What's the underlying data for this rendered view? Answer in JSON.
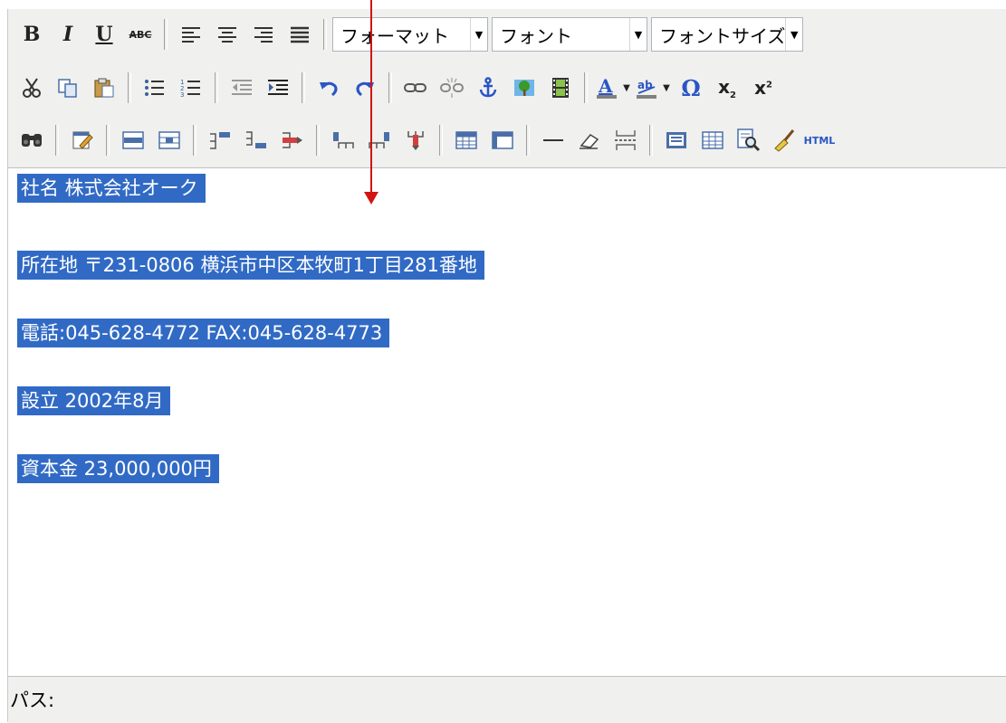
{
  "toolbar": {
    "row1": {
      "format_select": "フォーマット",
      "font_select": "フォント",
      "fontsize_select": "フォントサイズ"
    },
    "row3": {
      "html_label": "HTML"
    }
  },
  "editor": {
    "lines": [
      "社名 株式会社オーク",
      "所在地 〒231-0806 横浜市中区本牧町1丁目281番地",
      "電話:045-628-4772  FAX:045-628-4773",
      "設立 2002年8月",
      "資本金 23,000,000円"
    ]
  },
  "status": {
    "path_label": "パス:"
  },
  "colors": {
    "selection": "#316ac5",
    "toolbar_bg": "#f0f0ee",
    "annotation_arrow": "#d11414"
  }
}
